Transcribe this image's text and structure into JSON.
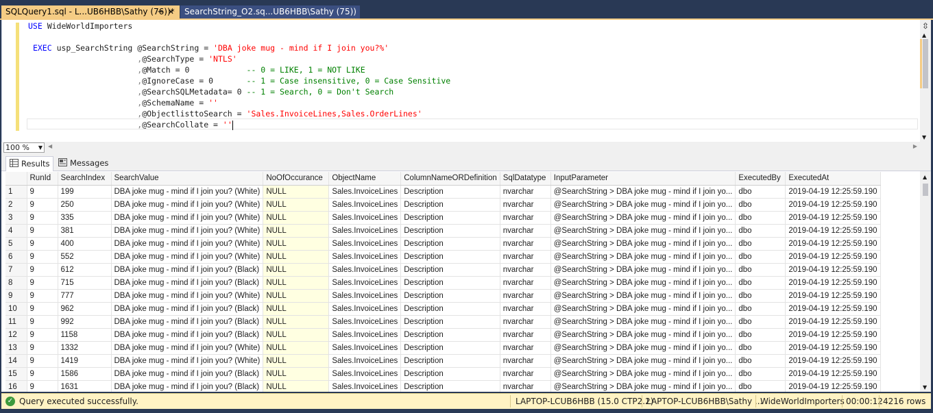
{
  "tabs": {
    "active": "SQLQuery1.sql - L...UB6HBB\\Sathy (76))*",
    "inactive": "SearchString_O2.sq...UB6HBB\\Sathy (75))"
  },
  "editor": {
    "line1_kw": "USE",
    "line1_rest": " WideWorldImporters",
    "exec_kw": "EXEC",
    "exec_proc": " usp_SearchString @SearchString = ",
    "exec_str": "'DBA joke mug - mind if I join you?%'",
    "p2_name": "@SearchType = ",
    "p2_val": "'NTLS'",
    "p3_name": "@Match = 0",
    "p3_cm": "-- 0 = LIKE, 1 = NOT LIKE",
    "p4_name": "@IgnoreCase = 0",
    "p4_cm": "-- 1 = Case insensitive, 0 = Case Sensitive",
    "p5_name": "@SearchSQLMetadata= 0",
    "p5_cm": "-- 1 = Search, 0 = Don't Search",
    "p6_name": "@SchemaName = ",
    "p6_val": "''",
    "p7_name": "@ObjectlisttoSearch = ",
    "p7_val": "'Sales.InvoiceLines,Sales.OrderLines'",
    "p8_name": "@SearchCollate = ",
    "p8_val": "''",
    "comma": ","
  },
  "zoom": "100 %",
  "result_tabs": {
    "results": "Results",
    "messages": "Messages"
  },
  "grid": {
    "columns": [
      "RunId",
      "SearchIndex",
      "SearchValue",
      "NoOfOccurance",
      "ObjectName",
      "ColumnNameORDefinition",
      "SqlDatatype",
      "InputParameter",
      "ExecutedBy",
      "ExecutedAt"
    ],
    "rows": [
      [
        "1",
        "9",
        "199",
        "DBA joke mug - mind if I join you? (White)",
        "NULL",
        "Sales.InvoiceLines",
        "Description",
        "nvarchar",
        "@SearchString > DBA joke mug - mind if I join yo...",
        "dbo",
        "2019-04-19 12:25:59.190"
      ],
      [
        "2",
        "9",
        "250",
        "DBA joke mug - mind if I join you? (White)",
        "NULL",
        "Sales.InvoiceLines",
        "Description",
        "nvarchar",
        "@SearchString > DBA joke mug - mind if I join yo...",
        "dbo",
        "2019-04-19 12:25:59.190"
      ],
      [
        "3",
        "9",
        "335",
        "DBA joke mug - mind if I join you? (White)",
        "NULL",
        "Sales.InvoiceLines",
        "Description",
        "nvarchar",
        "@SearchString > DBA joke mug - mind if I join yo...",
        "dbo",
        "2019-04-19 12:25:59.190"
      ],
      [
        "4",
        "9",
        "381",
        "DBA joke mug - mind if I join you? (White)",
        "NULL",
        "Sales.InvoiceLines",
        "Description",
        "nvarchar",
        "@SearchString > DBA joke mug - mind if I join yo...",
        "dbo",
        "2019-04-19 12:25:59.190"
      ],
      [
        "5",
        "9",
        "400",
        "DBA joke mug - mind if I join you? (White)",
        "NULL",
        "Sales.InvoiceLines",
        "Description",
        "nvarchar",
        "@SearchString > DBA joke mug - mind if I join yo...",
        "dbo",
        "2019-04-19 12:25:59.190"
      ],
      [
        "6",
        "9",
        "552",
        "DBA joke mug - mind if I join you? (White)",
        "NULL",
        "Sales.InvoiceLines",
        "Description",
        "nvarchar",
        "@SearchString > DBA joke mug - mind if I join yo...",
        "dbo",
        "2019-04-19 12:25:59.190"
      ],
      [
        "7",
        "9",
        "612",
        "DBA joke mug - mind if I join you? (Black)",
        "NULL",
        "Sales.InvoiceLines",
        "Description",
        "nvarchar",
        "@SearchString > DBA joke mug - mind if I join yo...",
        "dbo",
        "2019-04-19 12:25:59.190"
      ],
      [
        "8",
        "9",
        "715",
        "DBA joke mug - mind if I join you? (Black)",
        "NULL",
        "Sales.InvoiceLines",
        "Description",
        "nvarchar",
        "@SearchString > DBA joke mug - mind if I join yo...",
        "dbo",
        "2019-04-19 12:25:59.190"
      ],
      [
        "9",
        "9",
        "777",
        "DBA joke mug - mind if I join you? (White)",
        "NULL",
        "Sales.InvoiceLines",
        "Description",
        "nvarchar",
        "@SearchString > DBA joke mug - mind if I join yo...",
        "dbo",
        "2019-04-19 12:25:59.190"
      ],
      [
        "10",
        "9",
        "962",
        "DBA joke mug - mind if I join you? (Black)",
        "NULL",
        "Sales.InvoiceLines",
        "Description",
        "nvarchar",
        "@SearchString > DBA joke mug - mind if I join yo...",
        "dbo",
        "2019-04-19 12:25:59.190"
      ],
      [
        "11",
        "9",
        "992",
        "DBA joke mug - mind if I join you? (Black)",
        "NULL",
        "Sales.InvoiceLines",
        "Description",
        "nvarchar",
        "@SearchString > DBA joke mug - mind if I join yo...",
        "dbo",
        "2019-04-19 12:25:59.190"
      ],
      [
        "12",
        "9",
        "1158",
        "DBA joke mug - mind if I join you? (Black)",
        "NULL",
        "Sales.InvoiceLines",
        "Description",
        "nvarchar",
        "@SearchString > DBA joke mug - mind if I join yo...",
        "dbo",
        "2019-04-19 12:25:59.190"
      ],
      [
        "13",
        "9",
        "1332",
        "DBA joke mug - mind if I join you? (White)",
        "NULL",
        "Sales.InvoiceLines",
        "Description",
        "nvarchar",
        "@SearchString > DBA joke mug - mind if I join yo...",
        "dbo",
        "2019-04-19 12:25:59.190"
      ],
      [
        "14",
        "9",
        "1419",
        "DBA joke mug - mind if I join you? (White)",
        "NULL",
        "Sales.InvoiceLines",
        "Description",
        "nvarchar",
        "@SearchString > DBA joke mug - mind if I join yo...",
        "dbo",
        "2019-04-19 12:25:59.190"
      ],
      [
        "15",
        "9",
        "1586",
        "DBA joke mug - mind if I join you? (Black)",
        "NULL",
        "Sales.InvoiceLines",
        "Description",
        "nvarchar",
        "@SearchString > DBA joke mug - mind if I join yo...",
        "dbo",
        "2019-04-19 12:25:59.190"
      ],
      [
        "16",
        "9",
        "1631",
        "DBA joke mug - mind if I join you? (Black)",
        "NULL",
        "Sales.InvoiceLines",
        "Description",
        "nvarchar",
        "@SearchString > DBA joke mug - mind if I join yo...",
        "dbo",
        "2019-04-19 12:25:59.190"
      ]
    ]
  },
  "status": {
    "message": "Query executed successfully.",
    "server": "LAPTOP-LCUB6HBB (15.0 CTP2.2)",
    "user": "LAPTOP-LCUB6HBB\\Sathy ...",
    "database": "WideWorldImporters",
    "elapsed": "00:00:12",
    "rows": "4216 rows"
  },
  "colors": {
    "tab_active": "#f5cc84",
    "tab_inactive": "#3b4f81",
    "frame": "#293955",
    "status_bg": "#fff3c4",
    "keyword": "#0000ff",
    "string": "#ff0000",
    "comment": "#008000",
    "selected_col": "#ffffe1"
  },
  "icons": {
    "pin": "pin-icon",
    "close": "close-icon",
    "results": "grid-icon",
    "messages": "messages-icon",
    "success": "check-circle-icon"
  }
}
